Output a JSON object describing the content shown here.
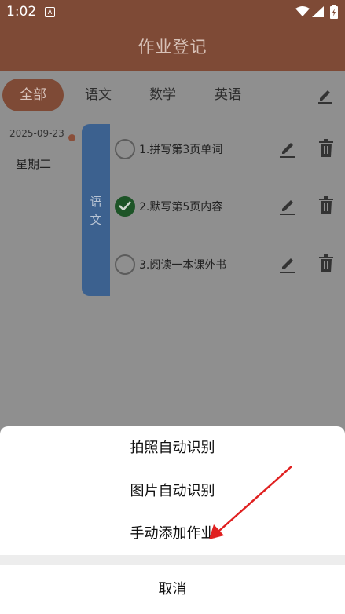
{
  "status_bar": {
    "time": "1:02",
    "notification_glyph": "A"
  },
  "header": {
    "title": "作业登记"
  },
  "tabs": [
    {
      "label": "全部",
      "active": true
    },
    {
      "label": "语文",
      "active": false
    },
    {
      "label": "数学",
      "active": false
    },
    {
      "label": "英语",
      "active": false
    }
  ],
  "day": {
    "date": "2025-09-23",
    "weekday": "星期二"
  },
  "subject": {
    "name": "语\n文",
    "color": "#3c618f"
  },
  "homework": [
    {
      "text": "1.拼写第3页单词",
      "done": false
    },
    {
      "text": "2.默写第5页内容",
      "done": true
    },
    {
      "text": "3.阅读一本课外书",
      "done": false
    }
  ],
  "action_sheet": {
    "items": [
      "拍照自动识别",
      "图片自动识别",
      "手动添加作业"
    ],
    "cancel": "取消"
  },
  "colors": {
    "header": "#7e4a36",
    "accent_check": "#1d5427",
    "arrow": "#e02020"
  }
}
